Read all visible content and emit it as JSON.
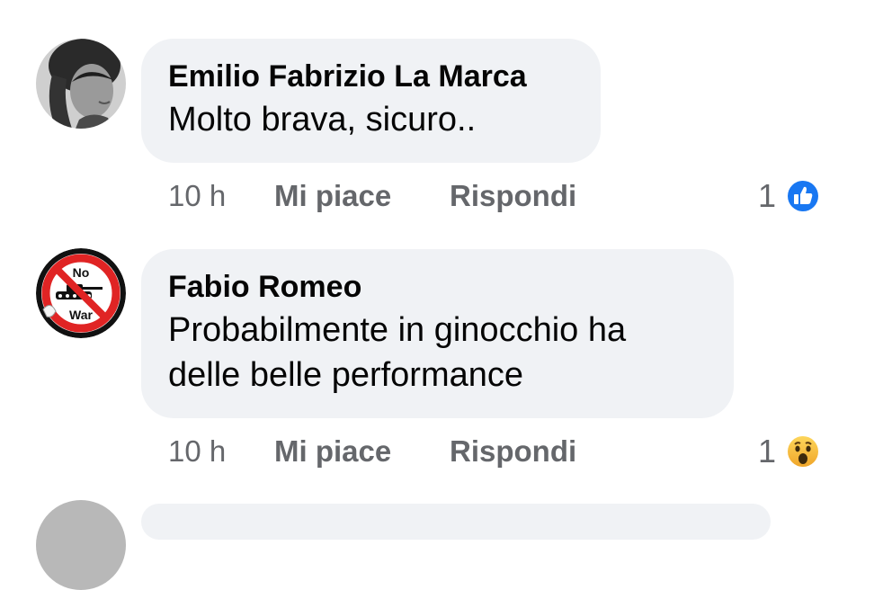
{
  "comments": [
    {
      "author": "Emilio Fabrizio La Marca",
      "text_lines": [
        "Molto brava, sicuro.."
      ],
      "time": "10 h",
      "like_label": "Mi piace",
      "reply_label": "Rispondi",
      "reaction_count": "1",
      "reaction_icon": "like-icon"
    },
    {
      "author": "Fabio Romeo",
      "text_lines": [
        "Probabilmente in ginocchio ha",
        "delle belle performance"
      ],
      "time": "10 h",
      "like_label": "Mi piace",
      "reply_label": "Rispondi",
      "reaction_count": "1",
      "reaction_icon": "wow-icon",
      "avatar_badge": {
        "top": "No",
        "bottom": "War"
      }
    }
  ],
  "colors": {
    "bubble": "#f0f2f5",
    "meta_text": "#65676b",
    "like_blue": "#1877f2",
    "no_war_red": "#e02424"
  }
}
